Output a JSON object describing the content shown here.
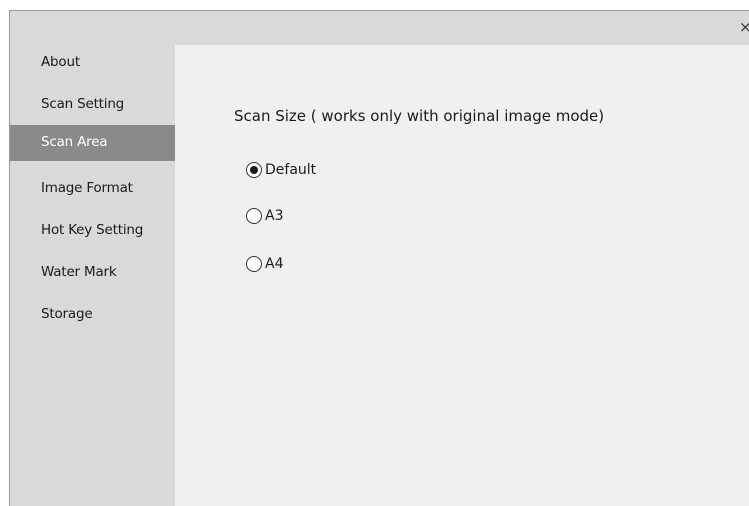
{
  "window": {
    "close_glyph": "×"
  },
  "sidebar": {
    "items": [
      {
        "label": "About"
      },
      {
        "label": "Scan Setting"
      },
      {
        "label": "Scan Area"
      },
      {
        "label": "Image Format"
      },
      {
        "label": "Hot Key Setting"
      },
      {
        "label": "Water Mark"
      },
      {
        "label": "Storage"
      }
    ],
    "active_index": 2
  },
  "main": {
    "section_title": "Scan Size ( works only with original image mode)",
    "options": [
      {
        "label": "Default",
        "checked": true
      },
      {
        "label": "A3",
        "checked": false
      },
      {
        "label": "A4",
        "checked": false
      }
    ]
  }
}
